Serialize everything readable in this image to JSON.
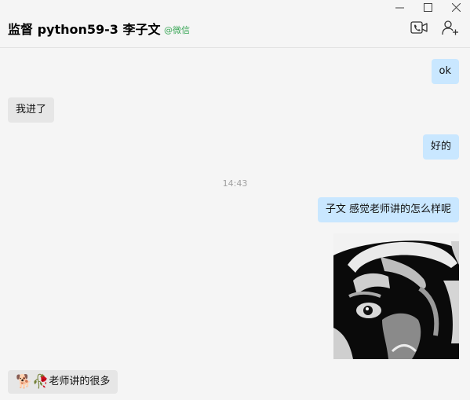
{
  "window": {
    "minimize_glyph": "—",
    "maximize_glyph": "☐",
    "close_glyph": "✕"
  },
  "header": {
    "title": "监督 python59-3 李子文",
    "source_tag": "@微信",
    "video_call_icon": "video-call-icon",
    "add_member_icon": "add-member-icon"
  },
  "messages": [
    {
      "side": "right",
      "text": "ok"
    },
    {
      "side": "left",
      "text": "我进了"
    },
    {
      "side": "right",
      "text": "好的"
    },
    {
      "timestamp": "14:43"
    },
    {
      "side": "right",
      "text": "子文 感觉老师讲的怎么样呢"
    },
    {
      "side": "right",
      "sticker": "meme-face-sticker"
    },
    {
      "side": "left",
      "emoji_1": "🐕",
      "emoji_2": "🥀",
      "text": "老师讲的很多"
    }
  ],
  "colors": {
    "background": "#f5f5f5",
    "my_bubble": "#c9e7ff",
    "their_bubble": "#e6e6e6",
    "source_tag": "#3aa757",
    "timestamp": "#a0a0a0"
  }
}
